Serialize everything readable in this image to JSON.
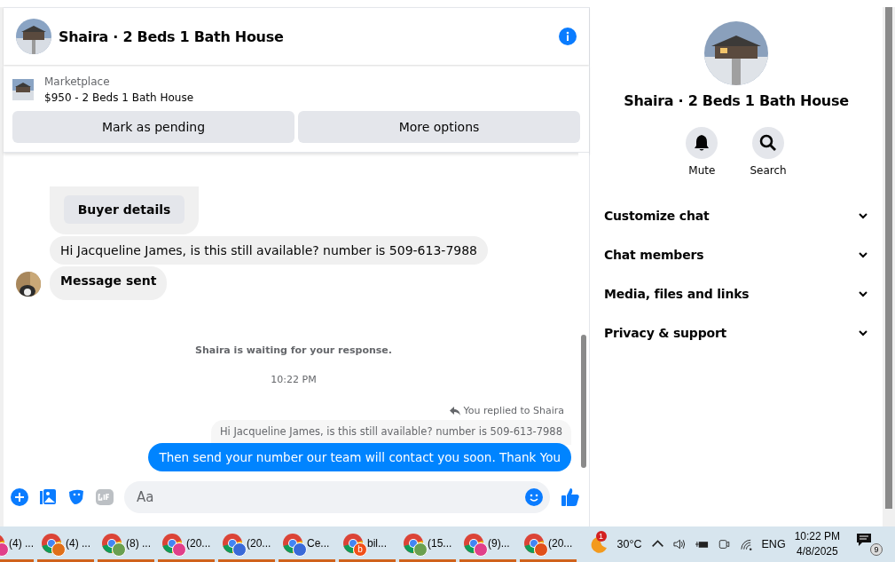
{
  "chat_header": {
    "title": "Shaira · 2 Beds 1 Bath House"
  },
  "listing": {
    "source": "Marketplace",
    "title": "$950 - 2 Beds 1 Bath House",
    "buttons": [
      "Mark as pending",
      "More options"
    ]
  },
  "messages": [
    {
      "kind": "card_button",
      "text": "Buyer details"
    },
    {
      "kind": "incoming",
      "text": "Hi Jacqueline James, is this still available? number is 509-613-7988",
      "avatar": false,
      "bold": false
    },
    {
      "kind": "incoming",
      "text": "Message sent",
      "avatar": true,
      "bold": true
    },
    {
      "kind": "notice",
      "text": "Shaira is waiting for your response."
    },
    {
      "kind": "time",
      "text": "10:22 PM"
    },
    {
      "kind": "reply_label",
      "text": "You replied to Shaira"
    },
    {
      "kind": "quoted",
      "text": "Hi Jacqueline James, is this still available? number is 509-613-7988"
    },
    {
      "kind": "outgoing",
      "text": "Then send your number our team will contact you soon. Thank You"
    }
  ],
  "composer": {
    "placeholder": "Aa"
  },
  "details": {
    "title": "Shaira · 2 Beds 1 Bath House",
    "actions": [
      {
        "kind": "bell",
        "label": "Mute"
      },
      {
        "kind": "search",
        "label": "Search"
      }
    ],
    "sections": [
      {
        "label": "Customize chat",
        "expanded": false
      },
      {
        "label": "Chat members",
        "expanded": false
      },
      {
        "label": "Media, files and links",
        "expanded": false
      },
      {
        "label": "Privacy & support",
        "expanded": false
      }
    ]
  },
  "taskbar": {
    "apps": [
      {
        "label": "(4) ...",
        "color": "#e0408a"
      },
      {
        "label": "(4) ...",
        "color": "#e0701a"
      },
      {
        "label": "(8) ...",
        "color": "#6aa050"
      },
      {
        "label": "(20...",
        "color": "#e0408a"
      },
      {
        "label": "(20...",
        "color": "#3a6ad8"
      },
      {
        "label": "Ce...",
        "color": "#3a6ad8"
      },
      {
        "label": "bil...",
        "color": "#f0501a",
        "badge_text": "b"
      },
      {
        "label": "(15...",
        "color": "#6aa050"
      },
      {
        "label": "(9)...",
        "color": "#e0408a"
      },
      {
        "label": "(20...",
        "color": "#e0501a"
      }
    ],
    "weather_badge": "1",
    "temperature": "30°C",
    "language": "ENG",
    "time": "10:22 PM",
    "date": "4/8/2025",
    "notifications": "9"
  }
}
